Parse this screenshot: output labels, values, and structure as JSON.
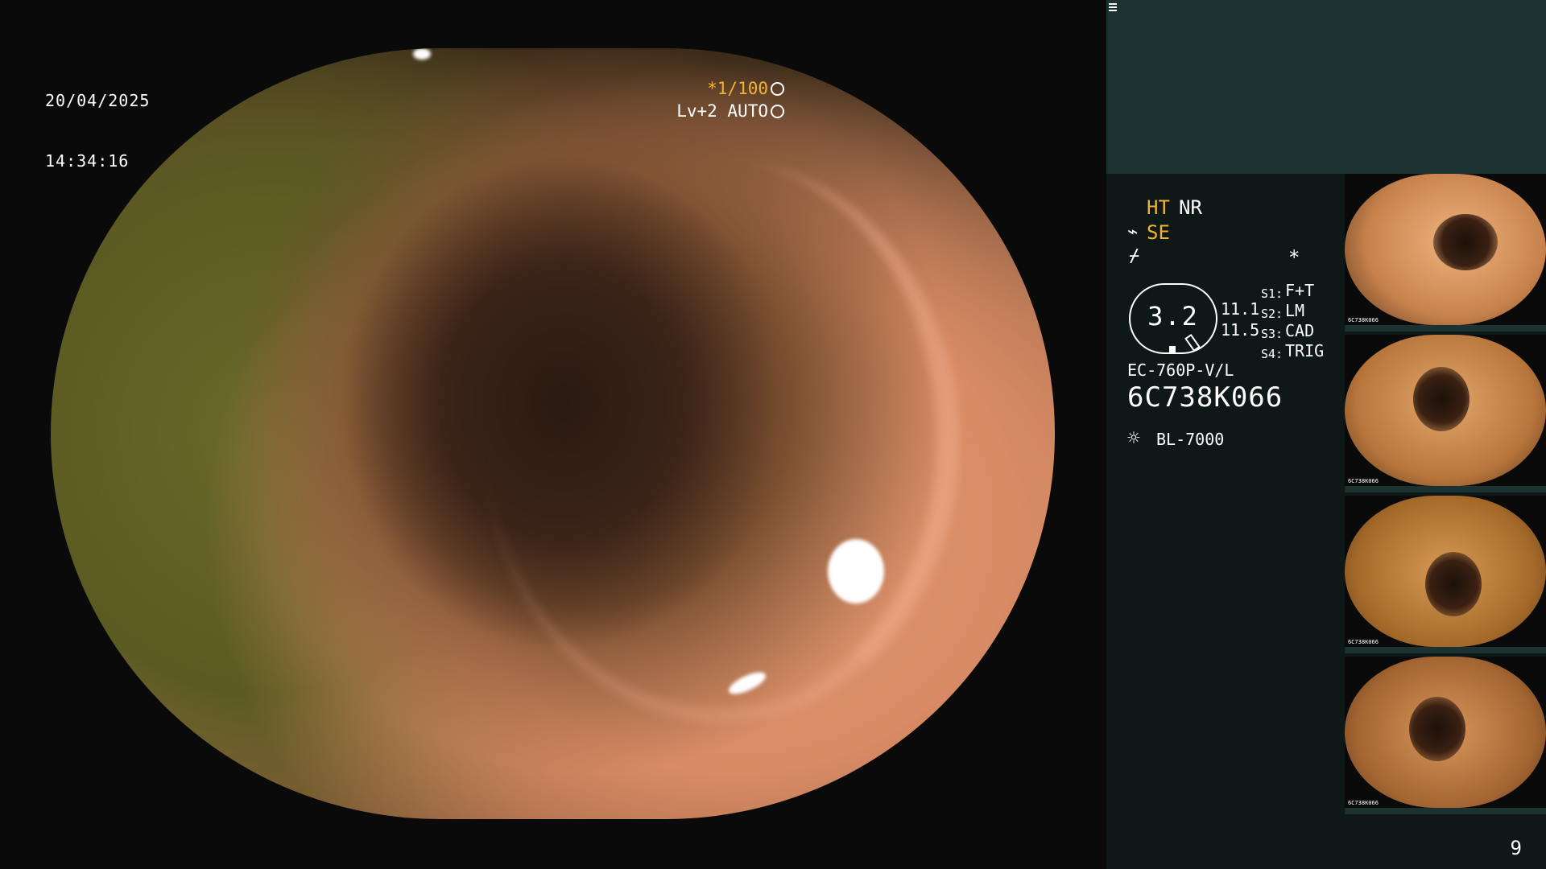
{
  "overlay": {
    "date": "20/04/2025",
    "time": "14:34:16",
    "shutter": "*1/100",
    "shutter_icon": "aperture-icon",
    "level": "Lv+2 AUTO",
    "auto_icon": "auto-iris-icon"
  },
  "panel": {
    "ht_label": "HT",
    "nr_label": "NR",
    "se_label": "SE",
    "se_icon": "scope-settings-icon",
    "wave_icon": "enhancement-icon",
    "memo_icon": "memo-icon",
    "star": "*",
    "magnification": "3.2",
    "value_a": "11.1",
    "value_b": "11.5",
    "switches": [
      {
        "key": "S1:",
        "value": "F+T"
      },
      {
        "key": "S2:",
        "value": "LM"
      },
      {
        "key": "S3:",
        "value": "CAD"
      },
      {
        "key": "S4:",
        "value": "TRIG"
      }
    ],
    "scope_model": "EC-760P-V/L",
    "scope_serial": "6C738K066",
    "light_icon": "light-source-icon",
    "light_source": "BL-7000",
    "page_number": "9"
  },
  "thumbnails": [
    {
      "caption": "6C738K066"
    },
    {
      "caption": "6C738K066"
    },
    {
      "caption": "6C738K066"
    },
    {
      "caption": "6C738K066"
    }
  ],
  "colors": {
    "amber": "#f2b233",
    "panel_bg": "#0e1817",
    "panel_top": "#1b3230"
  }
}
